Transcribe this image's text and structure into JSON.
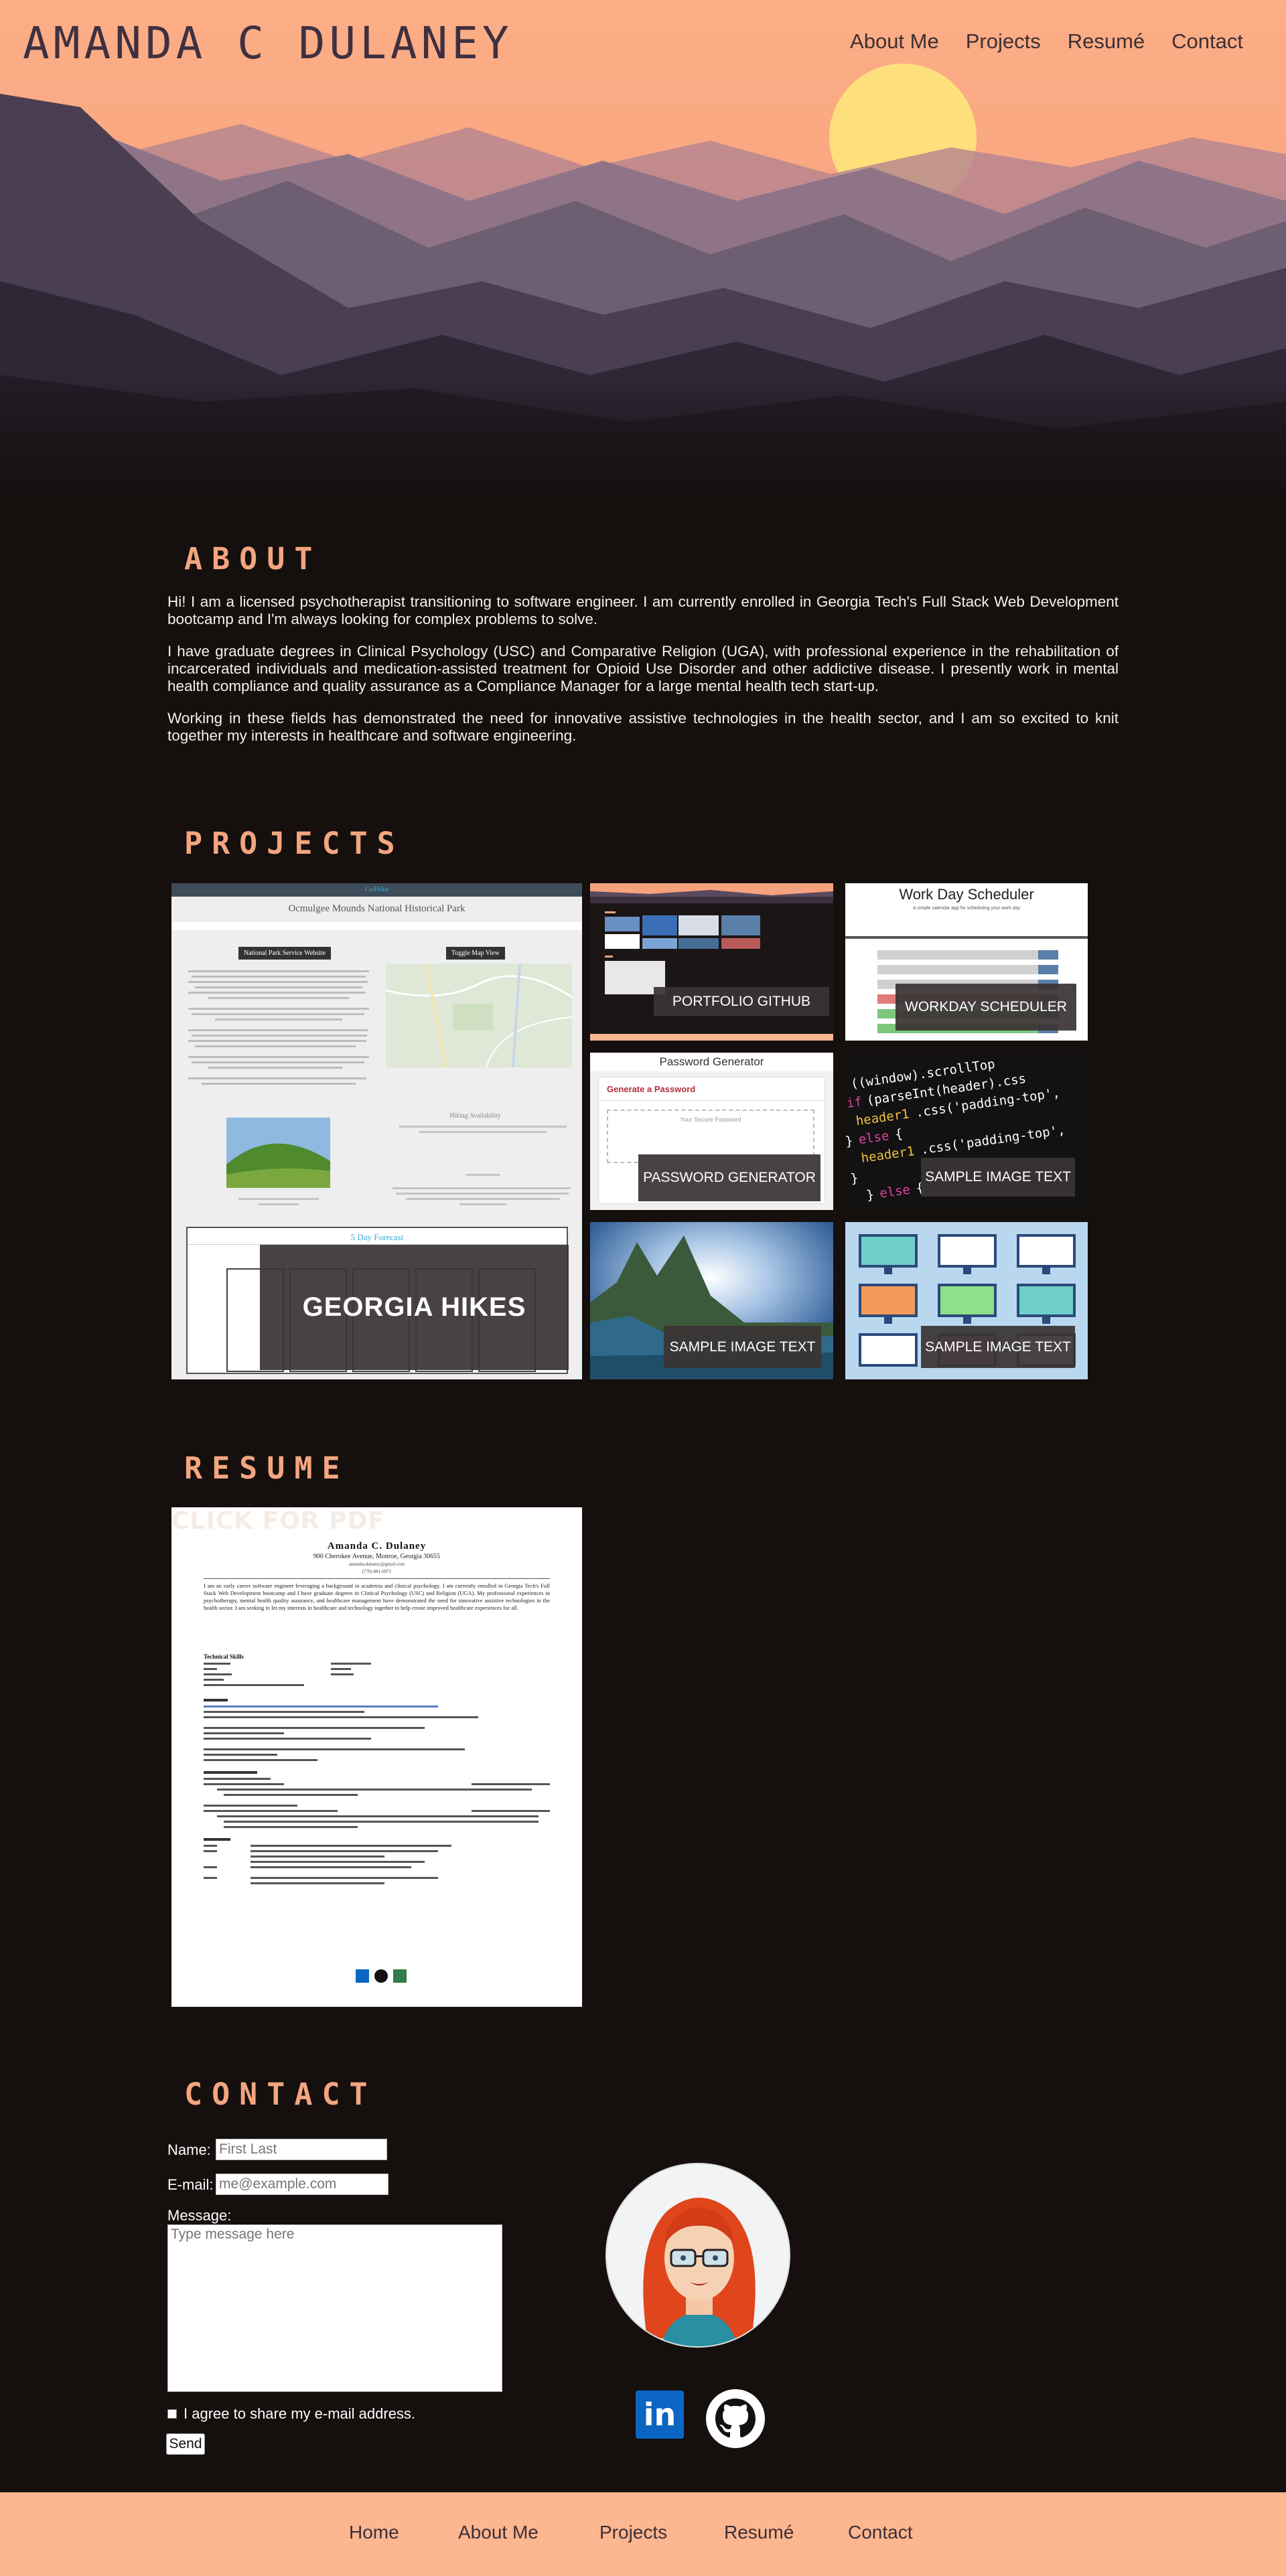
{
  "site": {
    "title": "AMANDA C DULANEY"
  },
  "nav": {
    "items": [
      "About Me",
      "Projects",
      "Resumé",
      "Contact"
    ]
  },
  "about": {
    "heading": "ABOUT",
    "paragraphs": [
      "Hi! I am a licensed psychotherapist transitioning to software engineer. I am currently enrolled in Georgia Tech's Full Stack Web Development bootcamp and I'm always looking for complex problems to solve.",
      "I have graduate degrees in Clinical Psychology (USC) and Comparative Religion (UGA), with professional experience in the rehabilitation of incarcerated individuals and medication-assisted treatment for Opioid Use Disorder and other addictive disease. I presently work in mental health compliance and quality assurance as a Compliance Manager for a large mental health tech start-up.",
      "Working in these fields has demonstrated the need for innovative assistive technologies in the health sector, and I am so excited to knit together my interests in healthcare and software engineering."
    ]
  },
  "projects": {
    "heading": "PROJECTS",
    "featured": {
      "label": "GEORGIA HIKES",
      "screenshot": {
        "logo": "GoHike",
        "page_title": "Ocmulgee Mounds National Historical Park",
        "btn_park": "National Park Service Website",
        "btn_map": "Toggle Map View",
        "hiking_title": "Hiking Availability",
        "weather_title": "5 Day Forecast"
      }
    },
    "tiles": [
      {
        "label": "PORTFOLIO GITHUB"
      },
      {
        "label": "WORKDAY SCHEDULER",
        "title": "Work Day Scheduler",
        "subtitle": "A simple calendar app for scheduling your work day"
      },
      {
        "label": "PASSWORD GENERATOR",
        "title": "Password Generator",
        "subtitle": "Generate a Password",
        "placeholder": "Your Secure Password"
      },
      {
        "label": "SAMPLE IMAGE TEXT"
      },
      {
        "label": "SAMPLE IMAGE TEXT"
      },
      {
        "label": "SAMPLE IMAGE TEXT"
      }
    ]
  },
  "resume": {
    "heading": "RESUME",
    "label": "CLICK FOR PDF",
    "name": "Amanda C. Dulaney",
    "address": "900 Cherokee Avenue, Monroe, Georgia 30655",
    "email": "amandacdulaney@gmail.com",
    "phone": "(770) 881-6971",
    "summary": "I am an early career software engineer leveraging a background in academia and clinical psychology. I am currently enrolled in Georgia Tech's Full Stack Web Development bootcamp and I have graduate degrees in Clinical Psychology (USC) and Religion (UGA). My professional experiences in psychotherapy, mental health quality assurance, and healthcare management have demonstrated the need for innovative assistive technologies in the health sector. I am seeking to let my interests in healthcare and technology together to help create improved healthcare experiences for all.",
    "sections": [
      "Technical Skills",
      "Projects",
      "Recent Employment",
      "Education"
    ]
  },
  "contact": {
    "heading": "CONTACT",
    "name_label": "Name:",
    "name_placeholder": "First Last",
    "email_label": "E-mail:",
    "email_placeholder": "me@example.com",
    "message_label": "Message:",
    "message_placeholder": "Type message here",
    "consent_label": "I agree to share my e-mail address.",
    "send_label": "Send",
    "icons": [
      "linkedin-icon",
      "github-icon"
    ]
  },
  "footer": {
    "links": [
      "Home",
      "About Me",
      "Projects",
      "Resumé",
      "Contact"
    ]
  },
  "colors": {
    "accent": "#f3a57f",
    "footer_bg": "#fcb690",
    "page_bg": "#150f0e",
    "overlay": "#3a3434"
  }
}
